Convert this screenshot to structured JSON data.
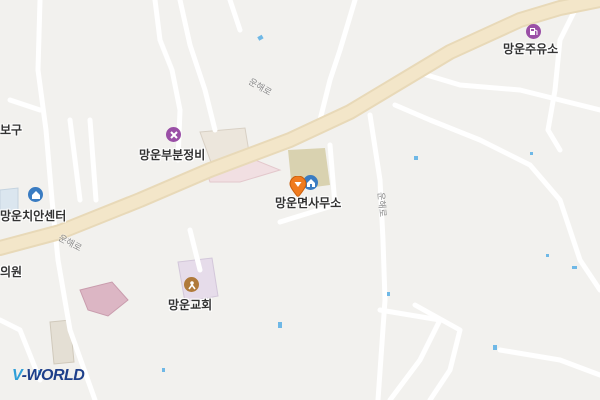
{
  "map": {
    "places": {
      "office": "망운면사무소",
      "gas_station": "망운주유소",
      "repair": "망운부분정비",
      "safety_center": "망운치안센터",
      "church": "망운교회",
      "partial_clinic": "의원",
      "partial_left": "보구"
    },
    "roads": {
      "unhae_1": "운해로",
      "unhae_2": "운해로",
      "unhae_3": "운해로"
    },
    "icons": {
      "office": "location-pin-icon",
      "office_building": "government-office-icon",
      "gas_station": "fuel-station-icon",
      "repair": "car-repair-icon",
      "safety_center": "police-icon",
      "church": "church-icon"
    },
    "colors": {
      "background": "#f2f1ee",
      "main_road": "#f2e4c6",
      "minor_road": "#ffffff",
      "water": "#6fb8e6",
      "poi_purple": "#9a4fa6",
      "poi_brown": "#b07a3a",
      "poi_blue": "#3a7cc2",
      "pin": "#f07b1e"
    }
  },
  "watermark": {
    "brand_v": "V",
    "brand_rest": "-WORLD"
  }
}
